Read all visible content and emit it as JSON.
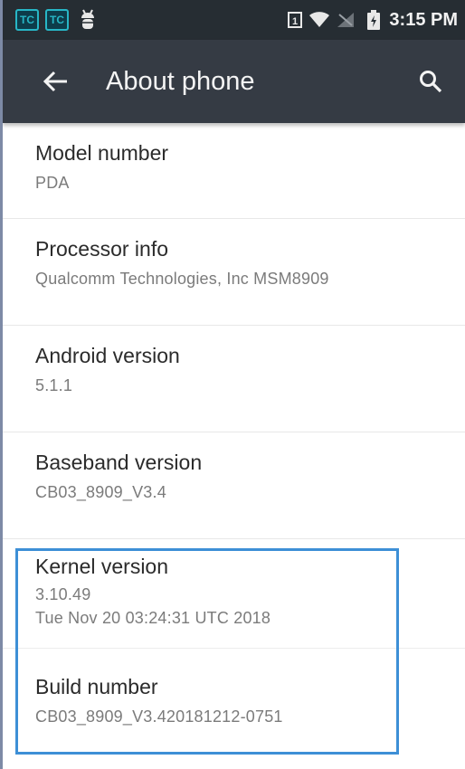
{
  "status_bar": {
    "notification_icons": [
      {
        "icon": "tc-app-icon",
        "text": "TC"
      },
      {
        "icon": "tc-app-icon",
        "text": "TC"
      }
    ],
    "debug_icon": "android-debug-icon",
    "sim_icon": "sim-1-icon",
    "wifi_icon": "wifi-icon",
    "no_signal_icon": "no-signal-icon",
    "battery_icon": "battery-charging-icon",
    "time": "3:15 PM"
  },
  "app_bar": {
    "back_icon": "back-arrow-icon",
    "title": "About phone",
    "search_icon": "search-icon"
  },
  "items": [
    {
      "title": "Model number",
      "lines": [
        "PDA"
      ]
    },
    {
      "title": "Processor info",
      "lines": [
        "Qualcomm Technologies, Inc MSM8909"
      ]
    },
    {
      "title": "Android version",
      "lines": [
        "5.1.1"
      ]
    },
    {
      "title": "Baseband version",
      "lines": [
        "CB03_8909_V3.4"
      ]
    },
    {
      "title": "Kernel version",
      "lines": [
        "3.10.49",
        "Tue Nov 20 03:24:31 UTC 2018"
      ]
    },
    {
      "title": "Build number",
      "lines": [
        "CB03_8909_V3.420181212-0751"
      ]
    }
  ],
  "colors": {
    "status_bar": "#262d33",
    "app_bar": "#353b44",
    "highlight": "#3d8fd6"
  }
}
